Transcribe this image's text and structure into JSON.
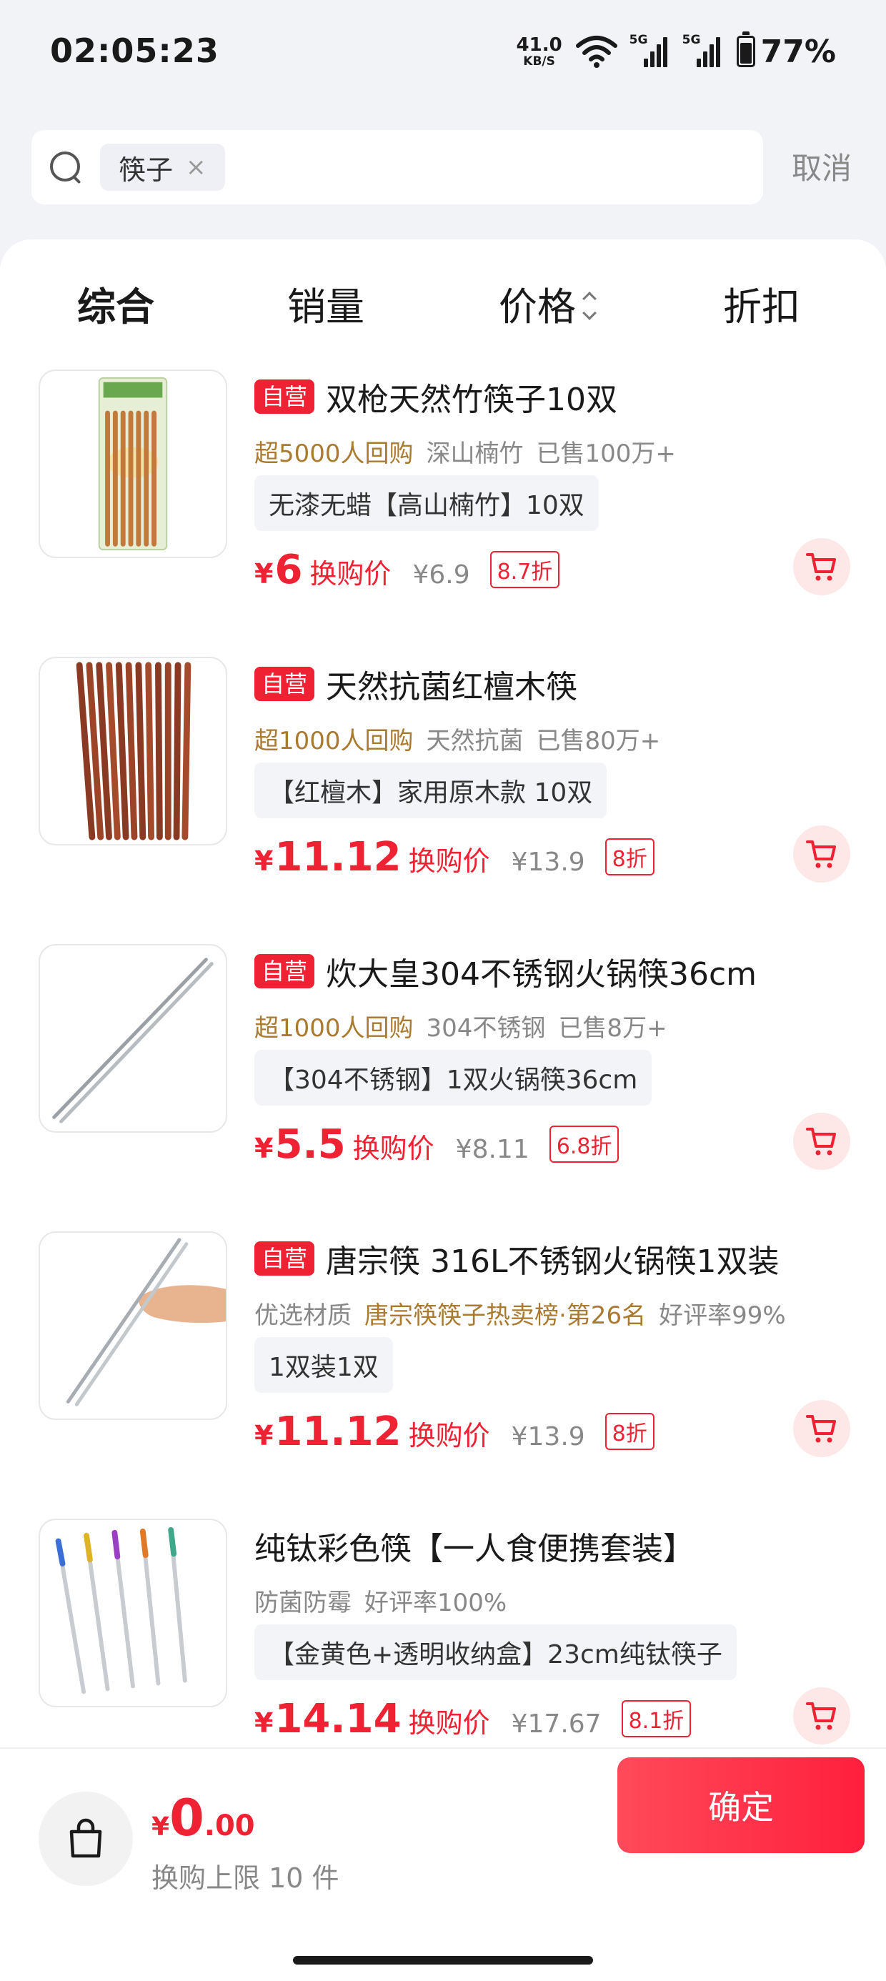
{
  "status_bar": {
    "time": "02:05:23",
    "net_speed_value": "41.0",
    "net_speed_unit": "KB/S",
    "signal_tag_1": "5G",
    "signal_tag_2": "5G",
    "battery_text": "77%",
    "battery_level": 0.77
  },
  "search": {
    "keyword": "筷子",
    "chip_close": "×",
    "cancel_label": "取消"
  },
  "sort_tabs": [
    {
      "label": "综合",
      "active": true
    },
    {
      "label": "销量",
      "active": false
    },
    {
      "label": "价格",
      "active": false
    },
    {
      "label": "折扣",
      "active": false
    }
  ],
  "products": [
    {
      "self_badge": "自营",
      "title": "双枪天然竹筷子10双",
      "meta": [
        {
          "text": "超5000人回购",
          "tone": "gold"
        },
        {
          "text": "深山楠竹",
          "tone": "gray"
        },
        {
          "text": "已售100万+",
          "tone": "gray"
        }
      ],
      "spec": "无漆无蜡【高山楠竹】10双",
      "currency": "¥",
      "price": "6",
      "price_label": "换购价",
      "original_price": "¥6.9",
      "discount": "8.7折",
      "thumb": "bamboo-pack-icon"
    },
    {
      "self_badge": "自营",
      "title": "天然抗菌红檀木筷",
      "meta": [
        {
          "text": "超1000人回购",
          "tone": "gold"
        },
        {
          "text": "天然抗菌",
          "tone": "gray"
        },
        {
          "text": "已售80万+",
          "tone": "gray"
        }
      ],
      "spec": "【红檀木】家用原木款 10双",
      "currency": "¥",
      "price": "11.12",
      "price_label": "换购价",
      "original_price": "¥13.9",
      "discount": "8折",
      "thumb": "red-wood-chopsticks-icon"
    },
    {
      "self_badge": "自营",
      "title": "炊大皇304不锈钢火锅筷36cm",
      "meta": [
        {
          "text": "超1000人回购",
          "tone": "gold"
        },
        {
          "text": "304不锈钢",
          "tone": "gray"
        },
        {
          "text": "已售8万+",
          "tone": "gray"
        }
      ],
      "spec": "【304不锈钢】1双火锅筷36cm",
      "currency": "¥",
      "price": "5.5",
      "price_label": "换购价",
      "original_price": "¥8.11",
      "discount": "6.8折",
      "thumb": "steel-chopsticks-icon"
    },
    {
      "self_badge": "自营",
      "title": "唐宗筷 316L不锈钢火锅筷1双装",
      "meta": [
        {
          "text": "优选材质",
          "tone": "gray"
        },
        {
          "text": "唐宗筷筷子热卖榜·第26名",
          "tone": "gold"
        },
        {
          "text": "好评率99%",
          "tone": "gray"
        }
      ],
      "spec": "1双装1双",
      "currency": "¥",
      "price": "11.12",
      "price_label": "换购价",
      "original_price": "¥13.9",
      "discount": "8折",
      "thumb": "hand-chopsticks-icon"
    },
    {
      "self_badge": "",
      "title": "纯钛彩色筷【一人食便携套装】",
      "meta": [
        {
          "text": "防菌防霉",
          "tone": "gray"
        },
        {
          "text": "好评率100%",
          "tone": "gray"
        }
      ],
      "spec": "【金黄色+透明收纳盒】23cm纯钛筷子",
      "currency": "¥",
      "price": "14.14",
      "price_label": "换购价",
      "original_price": "¥17.67",
      "discount": "8.1折",
      "thumb": "titanium-color-chopsticks-icon"
    }
  ],
  "bottom_bar": {
    "currency": "¥",
    "total_int": "0",
    "total_dec": ".00",
    "limit_text": "换购上限 10 件",
    "confirm_label": "确定"
  },
  "colors": {
    "accent": "#ee2233",
    "gold": "#a97a2f",
    "gray_text": "#888888",
    "background": "#f2f3f7"
  }
}
